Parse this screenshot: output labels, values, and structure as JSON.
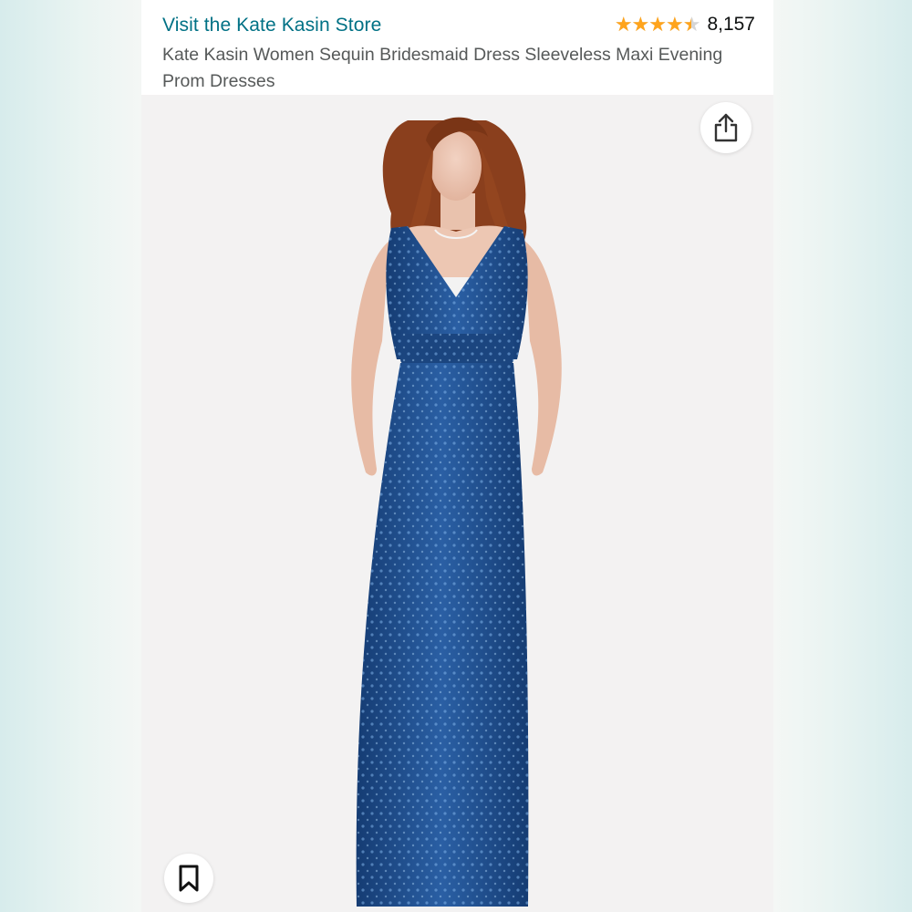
{
  "header": {
    "store_link": "Visit the Kate Kasin Store",
    "rating_value": 4.5,
    "rating_count": "8,157",
    "product_title": "Kate Kasin Women Sequin Bridesmaid Dress Sleeveless Maxi Evening Prom Dresses"
  },
  "icons": {
    "share": "share-icon",
    "save": "bookmark-icon",
    "star": "star-icon"
  },
  "product_image": {
    "alt": "Woman wearing a navy blue sequin sleeveless V-neck maxi dress"
  },
  "colors": {
    "link": "#007185",
    "star": "#ffa41c",
    "text": "#0f1111",
    "muted_text": "#565959",
    "dress": "#1e4e8c"
  }
}
